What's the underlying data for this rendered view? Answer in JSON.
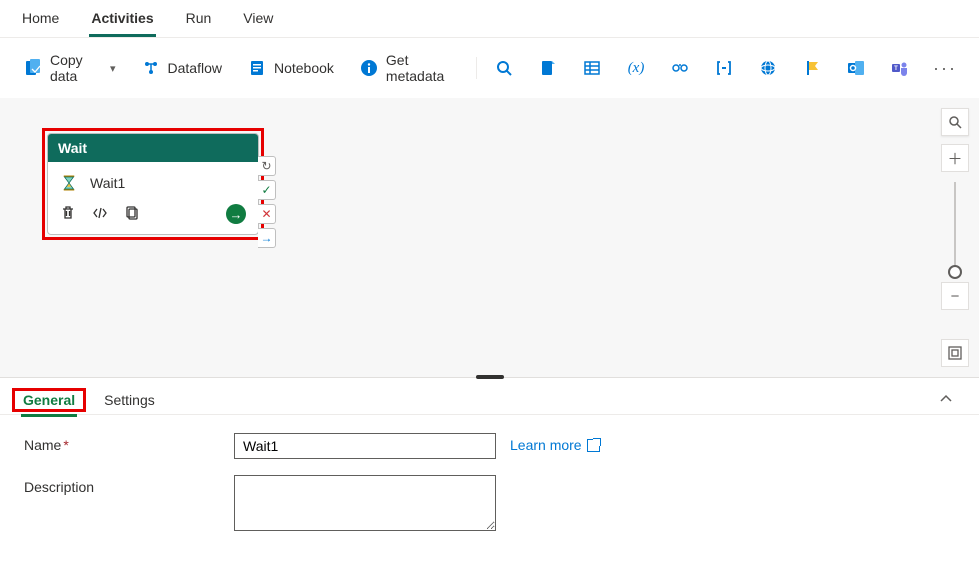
{
  "mainTabs": {
    "home": "Home",
    "activities": "Activities",
    "run": "Run",
    "view": "View",
    "active": "activities"
  },
  "toolbar": {
    "copyData": "Copy data",
    "dataflow": "Dataflow",
    "notebook": "Notebook",
    "getMetadata": "Get metadata"
  },
  "activity": {
    "type": "Wait",
    "name": "Wait1"
  },
  "panelTabs": {
    "general": "General",
    "settings": "Settings",
    "active": "general"
  },
  "form": {
    "nameLabel": "Name",
    "nameValue": "Wait1",
    "descriptionLabel": "Description",
    "descriptionValue": "",
    "learnMore": "Learn more"
  }
}
